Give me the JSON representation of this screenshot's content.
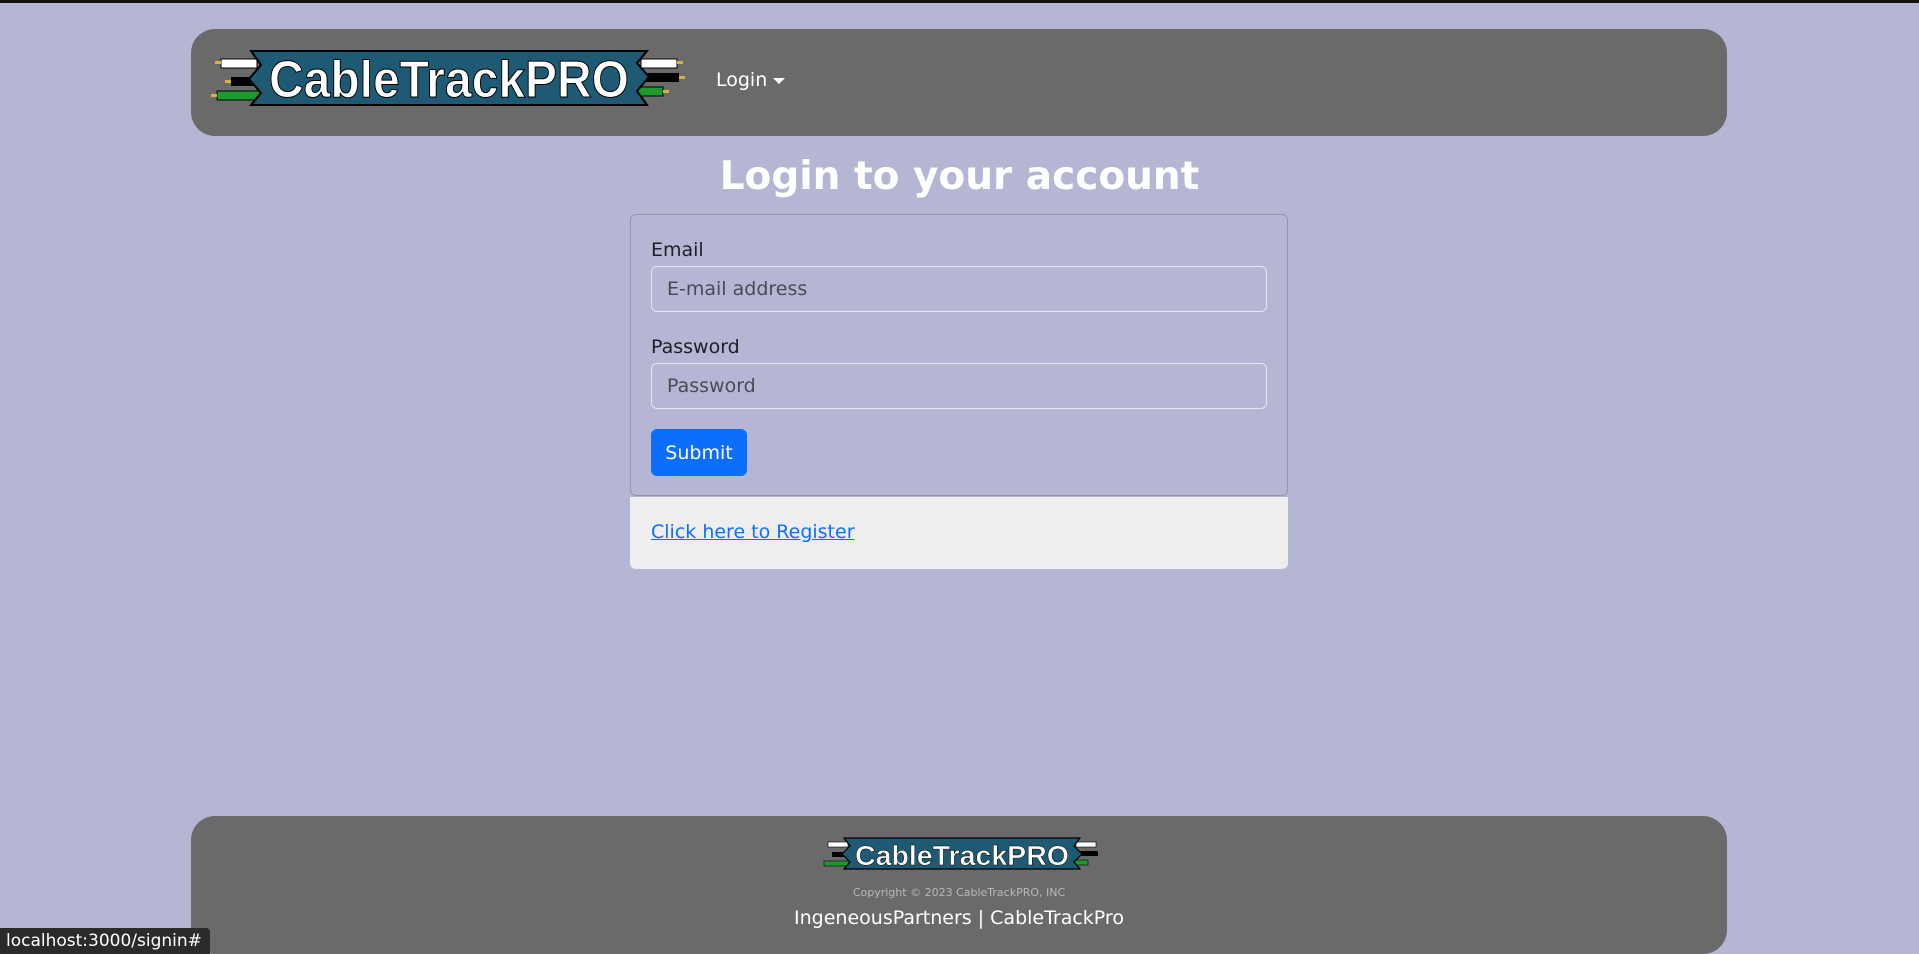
{
  "navbar": {
    "logo_text": "CableTrackPRO",
    "login_menu_label": "Login"
  },
  "main": {
    "title": "Login to your account",
    "email_label": "Email",
    "email_placeholder": "E-mail address",
    "password_label": "Password",
    "password_placeholder": "Password",
    "submit_label": "Submit",
    "register_link": "Click here to Register"
  },
  "footer": {
    "logo_text": "CableTrackPRO",
    "copyright": "Copyright © 2023 CableTrackPRO, INC",
    "links": "IngeneousPartners | CableTrackPro"
  },
  "status_bar": {
    "url": "localhost:3000/signin#"
  },
  "colors": {
    "background": "#b5b6d3",
    "navbar": "#696a69",
    "primary": "#0d6efd",
    "logo_banner": "#1f5a75"
  }
}
